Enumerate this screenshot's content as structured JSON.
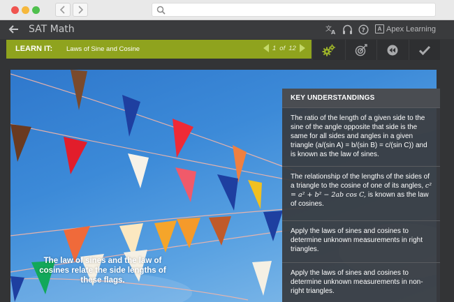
{
  "browser": {
    "back_icon": "chevron-left-icon",
    "forward_icon": "chevron-right-icon",
    "search_icon": "search-icon",
    "url_value": ""
  },
  "app": {
    "title": "SAT Math",
    "brand": "Apex Learning",
    "brand_mark": "A",
    "icons": [
      "translate-icon",
      "headphones-icon",
      "help-icon"
    ]
  },
  "lesson": {
    "tag": "LEARN IT:",
    "name": "Laws of Sine and Cosine",
    "page_current": "1",
    "page_of": "of",
    "page_total": "12",
    "accent": "#8fa31e"
  },
  "tools": [
    "gears-icon",
    "target-icon",
    "rewind-icon",
    "checkmark-icon"
  ],
  "scene": {
    "caption": "The law of sines and the law of cosines relate the side lengths of these flags."
  },
  "key_understandings": {
    "heading": "KEY UNDERSTANDINGS",
    "items": [
      {
        "text": "The ratio of the length of a given side to the sine of the angle opposite that side is the same for all sides and angles in a given triangle (a/(sin A) = b/(sin B) = c/(sin C)) and is known as the law of sines."
      },
      {
        "text_before": "The relationship of the lengths of the sides of a triangle to the cosine of one of its angles,",
        "formula": "c² = a² + b² − 2ab cos C,",
        "text_after": "is known as the law of cosines."
      },
      {
        "text": "Apply the laws of sines and cosines to determine unknown measurements in right triangles."
      },
      {
        "text": "Apply the laws of sines and cosines to determine unknown measurements in non-right triangles."
      }
    ]
  }
}
